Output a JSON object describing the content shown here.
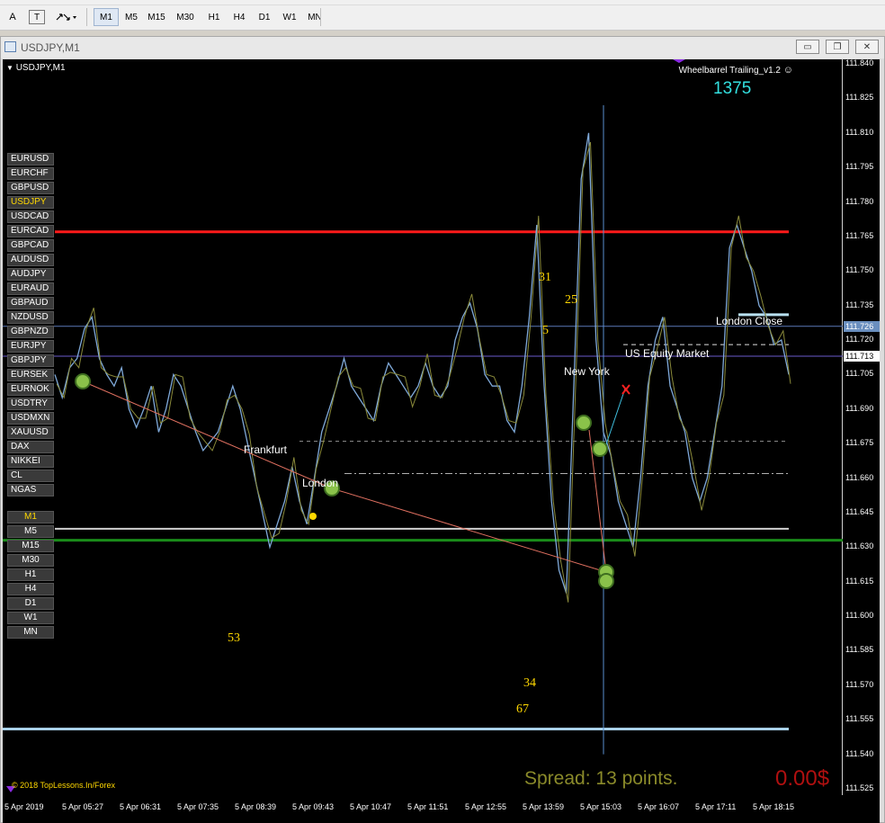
{
  "toolbar": {
    "text_tool": "A",
    "textlabel_tool": "T",
    "timeframes": [
      "M1",
      "M5",
      "M15",
      "M30",
      "H1",
      "H4",
      "D1",
      "W1",
      "MN"
    ],
    "active_timeframe": "M1"
  },
  "window": {
    "title": "USDJPY,M1",
    "min_label": "▭",
    "restore_label": "❐",
    "close_label": "✕"
  },
  "chart": {
    "header": "USDJPY,M1",
    "indicator_name": "Wheelbarrel Trailing_v1.2",
    "counter_top": "1375",
    "spread_text": "Spread: 13 points.",
    "profit_text": "0.00$",
    "copyright": "© 2018 TopLessons.In/Forex",
    "session_labels": {
      "frankfurt": "Frankfurt",
      "london": "London",
      "new_york": "New York",
      "us_equity": "US Equity Market",
      "london_close": "London Close"
    },
    "numbers": {
      "n31": "31",
      "n25": "25",
      "n5": "5",
      "n53": "53",
      "n34": "34",
      "n67": "67"
    },
    "symbols": [
      "EURUSD",
      "EURCHF",
      "GBPUSD",
      "USDJPY",
      "USDCAD",
      "EURCAD",
      "GBPCAD",
      "AUDUSD",
      "AUDJPY",
      "EURAUD",
      "GBPAUD",
      "NZDUSD",
      "GBPNZD",
      "EURJPY",
      "GBPJPY",
      "EURSEK",
      "EURNOK",
      "USDTRY",
      "USDMXN",
      "XAUUSD",
      "DAX",
      "NIKKEI",
      "CL",
      "NGAS"
    ],
    "active_symbol": "USDJPY",
    "tf_buttons": [
      "M1",
      "M5",
      "M15",
      "M30",
      "H1",
      "H4",
      "D1",
      "W1",
      "MN"
    ],
    "active_tf": "M1",
    "colors": {
      "red_line": "#ff1a1a",
      "green_line": "#1a8c1a",
      "blue_line": "#6a5acd",
      "price_series": "#7fa9d9",
      "counter": "#33e0e0",
      "spread": "#8a8a2a",
      "profit": "#b01010"
    }
  },
  "chart_data": {
    "type": "line",
    "title": "USDJPY,M1",
    "y_ticks": [
      "111.840",
      "111.825",
      "111.810",
      "111.795",
      "111.780",
      "111.765",
      "111.750",
      "111.735",
      "111.720",
      "111.705",
      "111.690",
      "111.675",
      "111.660",
      "111.645",
      "111.630",
      "111.615",
      "111.600",
      "111.585",
      "111.570",
      "111.555",
      "111.540",
      "111.525"
    ],
    "x_ticks": [
      "5 Apr 2019",
      "5 Apr 05:27",
      "5 Apr 06:31",
      "5 Apr 07:35",
      "5 Apr 08:39",
      "5 Apr 09:43",
      "5 Apr 10:47",
      "5 Apr 11:51",
      "5 Apr 12:55",
      "5 Apr 13:59",
      "5 Apr 15:03",
      "5 Apr 16:07",
      "5 Apr 17:11",
      "5 Apr 18:15"
    ],
    "ylim": [
      111.525,
      111.84
    ],
    "current_bid": "111.713",
    "current_ask": "111.726",
    "levels": {
      "resistance": 111.767,
      "support": 111.633,
      "low_line": 111.551
    },
    "series": [
      {
        "values": [
          111.705,
          111.695,
          111.708,
          111.712,
          111.725,
          111.73,
          111.712,
          111.705,
          111.7,
          111.708,
          111.69,
          111.682,
          111.69,
          111.7,
          111.68,
          111.69,
          111.705,
          111.7,
          111.69,
          111.68,
          111.672,
          111.676,
          111.68,
          111.69,
          111.7,
          111.69,
          111.675,
          111.66,
          111.645,
          111.63,
          111.64,
          111.65,
          111.665,
          111.65,
          111.64,
          111.66,
          111.68,
          111.69,
          111.7,
          111.712,
          111.7,
          111.695,
          111.69,
          111.685,
          111.7,
          111.71,
          111.705,
          111.7,
          111.695,
          111.7,
          111.71,
          111.7,
          111.695,
          111.7,
          111.72,
          111.73,
          111.736,
          111.725,
          111.705,
          111.7,
          111.7,
          111.685,
          111.68,
          111.7,
          111.73,
          111.77,
          111.7,
          111.65,
          111.62,
          111.61,
          111.7,
          111.79,
          111.81,
          111.72,
          111.68,
          111.67,
          111.65,
          111.64,
          111.63,
          111.66,
          111.7,
          111.72,
          111.73,
          111.7,
          111.69,
          111.68,
          111.66,
          111.65,
          111.66,
          111.68,
          111.7,
          111.76,
          111.77,
          111.76,
          111.75,
          111.735,
          111.73,
          111.718,
          111.72,
          111.705
        ]
      }
    ]
  }
}
